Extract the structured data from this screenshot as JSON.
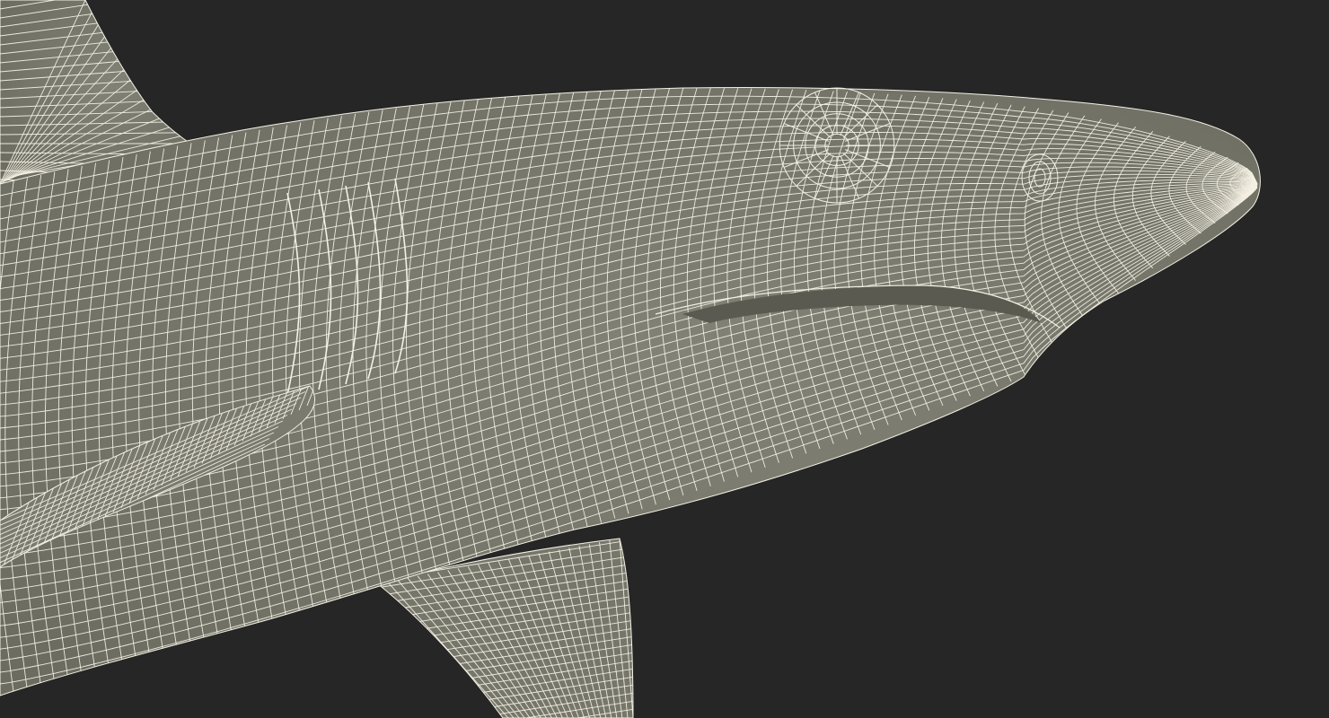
{
  "scene": {
    "subject": "shark-head-wireframe-mesh",
    "render_mode": "wireframe-over-shaded",
    "colors": {
      "background": "#262626",
      "surface": "#7b7b6f",
      "surface_shadow": "#5e5e54",
      "wire": "#f4f1e4"
    }
  }
}
